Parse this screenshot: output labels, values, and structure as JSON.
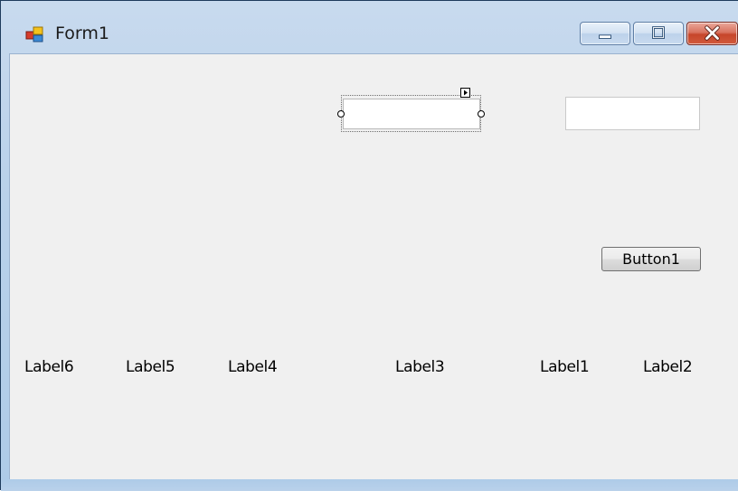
{
  "window": {
    "title": "Form1",
    "icon": "form-icon",
    "caption_buttons": [
      "minimize-icon",
      "maximize-icon",
      "close-icon"
    ]
  },
  "form": {
    "button1_label": "Button1",
    "textbox_selected_value": "",
    "textbox_right_value": "",
    "labels": {
      "label1": "Label1",
      "label2": "Label2",
      "label3": "Label3",
      "label4": "Label4",
      "label5": "Label5",
      "label6": "Label6"
    }
  }
}
